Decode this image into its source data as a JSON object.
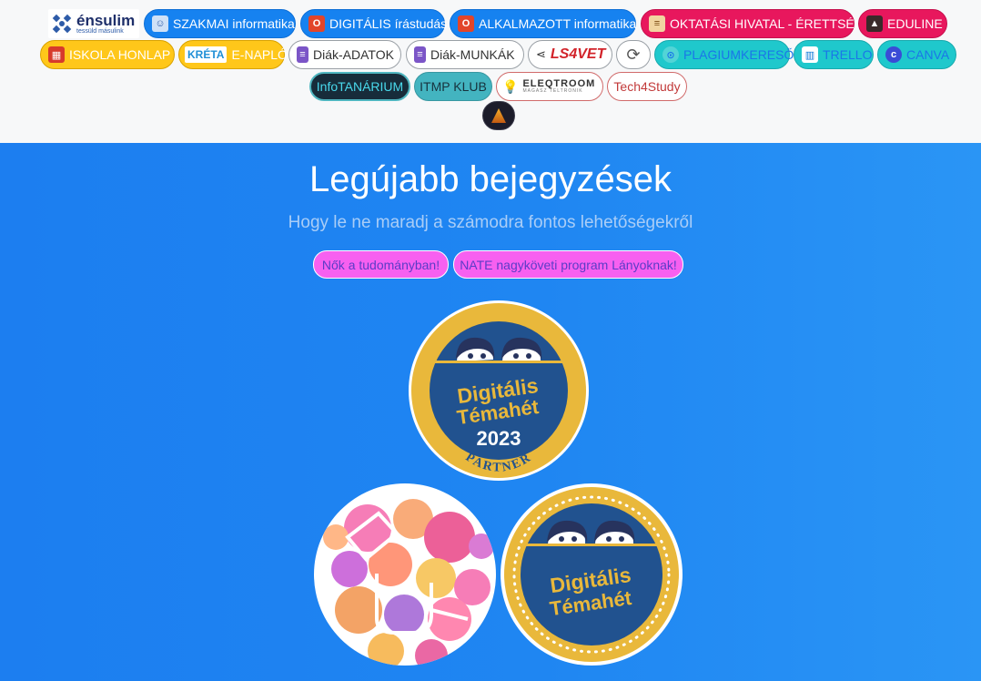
{
  "nav": {
    "row1": {
      "ensulim_logo": {
        "title": "énsulim",
        "subtitle": "tessüld másulink"
      },
      "szakmai": "SZAKMAI informatika",
      "digitalis": "DIGITÁLIS írástudás",
      "alkalmazott": "ALKALMAZOTT informatika",
      "oktatasi": "OKTATÁSI HIVATAL - ÉRETTSÉGI",
      "eduline": "EDULINE"
    },
    "row2": {
      "iskola": "ISKOLA HONLAP",
      "kreta_logo": "KRÉTA",
      "enaplo": "E-NAPLÓ",
      "diak_adatok": "Diák-ADATOK",
      "diak_munkak": "Diák-MUNKÁK",
      "ls4vet": "LS4VET",
      "plagium": "PLAGIUMKERESŐ",
      "trello": "TRELLO",
      "canva": "CANVA"
    },
    "row3": {
      "infotanarium": "InfoTANÁRIUM",
      "itmp": "ITMP KLUB",
      "eleqtroom_logo": "ELEQTROOM",
      "eleqtroom_tagline": "MAGASZ TELTRONIK",
      "tech4study": "Tech4Study"
    }
  },
  "hero": {
    "title": "Legújabb bejegyzések",
    "subtitle": "Hogy le ne maradj a számodra fontos lehetőségekről",
    "tags": [
      "Nők a tudományban!",
      "NATE nagyköveti program Lányoknak!"
    ]
  },
  "badges": {
    "main": {
      "line1": "Digitális",
      "line2": "Témahét",
      "year": "2023",
      "ribbon": "PARTNER"
    },
    "small": {
      "line1": "Digitális",
      "line2": "Témahét"
    }
  },
  "colors": {
    "accent_blue": "#1682f0",
    "accent_red": "#e8175d",
    "accent_yellow": "#ffc71a",
    "tag_pink": "#f760f0",
    "badge_gold": "#e9b83b",
    "badge_navy": "#21528f"
  }
}
